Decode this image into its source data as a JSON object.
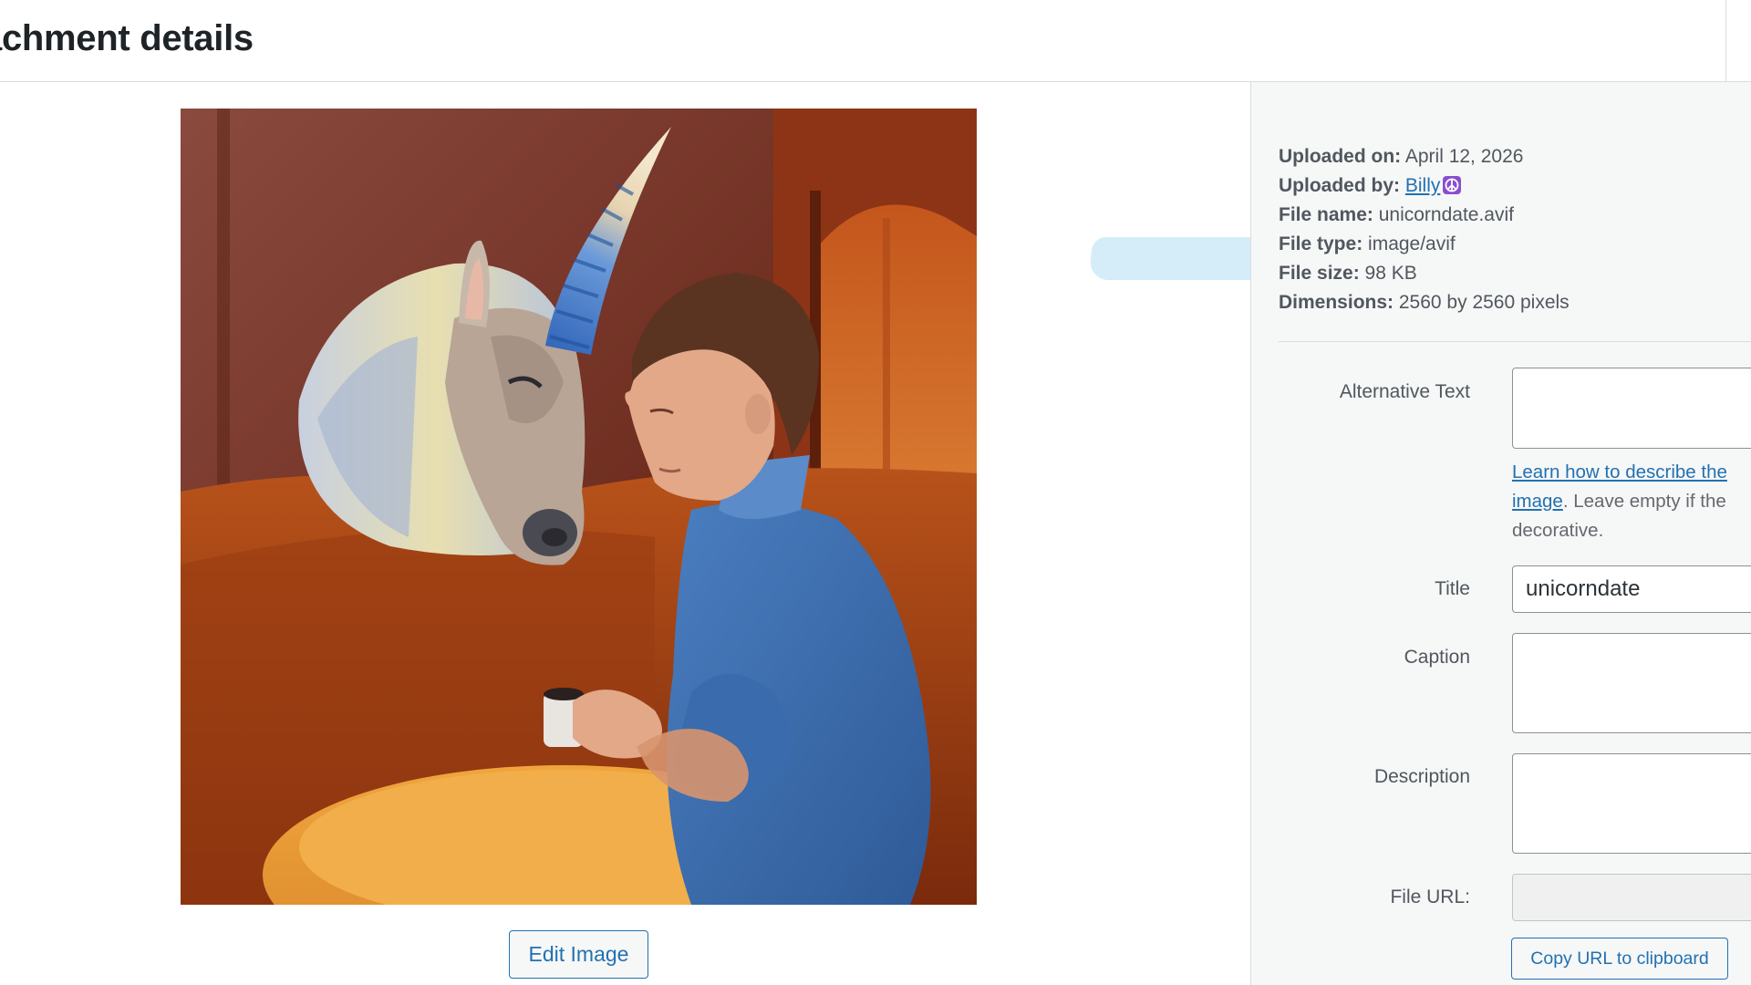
{
  "header": {
    "title": "achment details"
  },
  "media": {
    "edit_button_label": "Edit Image",
    "image_subject": "painting of a unicorn and a man in a blue sweater seated in an orange booth"
  },
  "file_info": {
    "uploaded_on_label": "Uploaded on:",
    "uploaded_on_value": "April 12, 2026",
    "uploaded_by_label": "Uploaded by:",
    "uploaded_by_value": "Billy",
    "uploaded_by_emoji_icon": "peace-symbol-icon",
    "file_name_label": "File name:",
    "file_name_value": "unicorndate.avif",
    "file_type_label": "File type:",
    "file_type_value": "image/avif",
    "file_size_label": "File size:",
    "file_size_value": "98 KB",
    "dimensions_label": "Dimensions:",
    "dimensions_value": "2560 by 2560 pixels"
  },
  "fields": {
    "alt_text_label": "Alternative Text",
    "alt_text_value": "",
    "alt_help_link": "Learn how to describe the",
    "alt_help_link_2": "image",
    "alt_help_text_1": ". Leave empty if the",
    "alt_help_text_2": "decorative.",
    "title_label": "Title",
    "title_value": "unicorndate",
    "caption_label": "Caption",
    "caption_value": "",
    "description_label": "Description",
    "description_value": "",
    "file_url_label": "File URL:",
    "file_url_value": "",
    "copy_url_button_label": "Copy URL to clipboard"
  },
  "colors": {
    "accent": "#2271b1",
    "sidebar_bg": "#f6f7f7",
    "highlight": "#d3ecf8"
  }
}
